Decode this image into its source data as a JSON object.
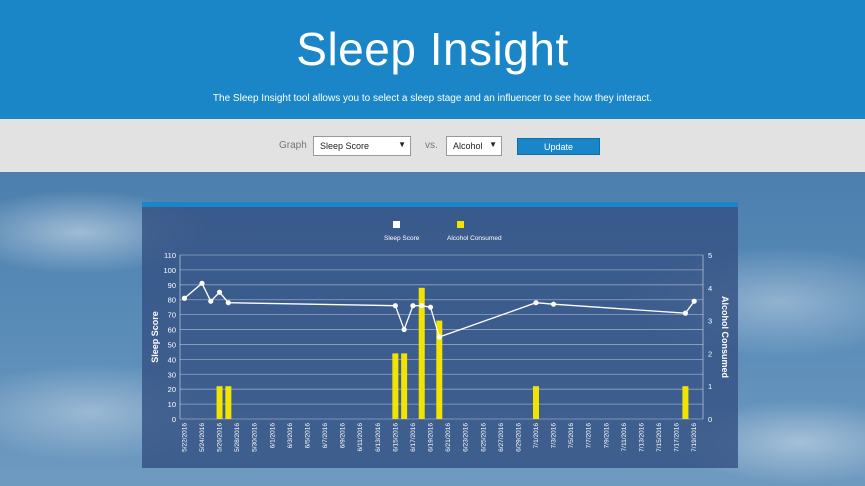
{
  "header": {
    "title": "Sleep Insight",
    "subtitle": "The Sleep Insight tool allows you to select a sleep stage and an influencer to see how they interact."
  },
  "controls": {
    "graph_label": "Graph",
    "stage_value": "Sleep Score",
    "vs_label": "vs.",
    "influencer_value": "Alcohol",
    "update_label": "Update"
  },
  "chart_data": {
    "type": "bar",
    "title": "",
    "ylabel": "Sleep Score",
    "y2label": "Alcohol Consumed",
    "ylim": [
      0,
      110
    ],
    "y2lim": [
      0,
      5
    ],
    "yticks": [
      0,
      10,
      20,
      30,
      40,
      50,
      60,
      70,
      80,
      90,
      100,
      110
    ],
    "y2ticks": [
      0,
      1,
      2,
      3,
      4,
      5
    ],
    "legend_position": "top",
    "grid": true,
    "categories": [
      "5/22/2016",
      "5/24/2016",
      "5/26/2016",
      "5/28/2016",
      "5/30/2016",
      "6/1/2016",
      "6/3/2016",
      "6/5/2016",
      "6/7/2016",
      "6/9/2016",
      "6/11/2016",
      "6/13/2016",
      "6/15/2016",
      "6/17/2016",
      "6/19/2016",
      "6/21/2016",
      "6/23/2016",
      "6/25/2016",
      "6/27/2016",
      "6/29/2016",
      "7/1/2016",
      "7/3/2016",
      "7/5/2016",
      "7/7/2016",
      "7/9/2016",
      "7/11/2016",
      "7/13/2016",
      "7/15/2016",
      "7/17/2016",
      "7/19/2016"
    ],
    "series": [
      {
        "name": "Sleep Score",
        "kind": "line",
        "color": "#ffffff",
        "points": [
          {
            "x": 0,
            "y": 81
          },
          {
            "x": 2,
            "y": 91
          },
          {
            "x": 3,
            "y": 79
          },
          {
            "x": 4,
            "y": 85
          },
          {
            "x": 5,
            "y": 78
          },
          {
            "x": 24,
            "y": 76
          },
          {
            "x": 25,
            "y": 60
          },
          {
            "x": 26,
            "y": 76
          },
          {
            "x": 27,
            "y": 76
          },
          {
            "x": 28,
            "y": 75
          },
          {
            "x": 29,
            "y": 55
          },
          {
            "x": 40,
            "y": 78
          },
          {
            "x": 42,
            "y": 77
          },
          {
            "x": 57,
            "y": 71
          },
          {
            "x": 58,
            "y": 79
          }
        ]
      },
      {
        "name": "Alcohol Consumed",
        "kind": "bar",
        "color": "#f3e400",
        "points": [
          {
            "x": 4,
            "y": 1
          },
          {
            "x": 5,
            "y": 1
          },
          {
            "x": 24,
            "y": 2
          },
          {
            "x": 25,
            "y": 2
          },
          {
            "x": 27,
            "y": 4
          },
          {
            "x": 29,
            "y": 3
          },
          {
            "x": 40,
            "y": 1
          },
          {
            "x": 57,
            "y": 1
          }
        ]
      }
    ]
  },
  "colors": {
    "header_bg": "#1a86c8",
    "bar": "#f3e400",
    "line": "#ffffff"
  }
}
